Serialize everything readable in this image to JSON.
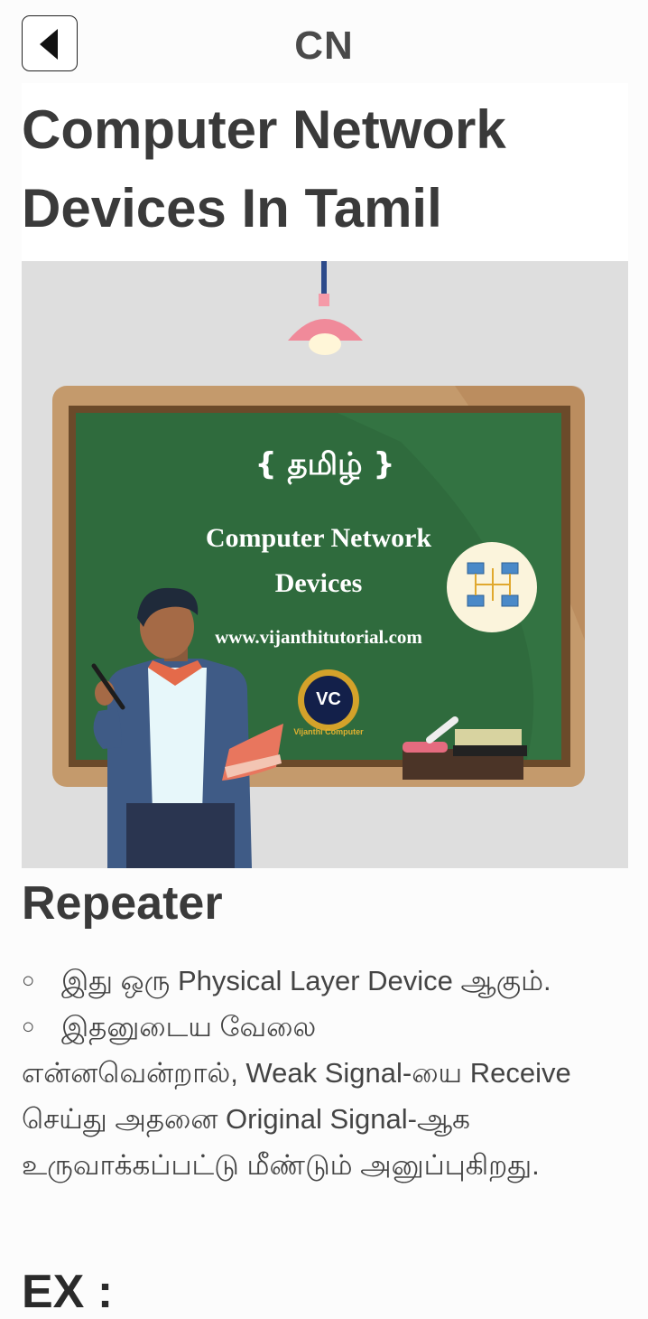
{
  "header": {
    "app_title": "CN",
    "back_icon": "chevron-left-icon"
  },
  "article": {
    "title": "Computer Network Devices In Tamil"
  },
  "hero": {
    "board_tag": "{ தமிழ் }",
    "board_title_line1": "Computer Network",
    "board_title_line2": "Devices",
    "board_url": "www.vijanthitutorial.com",
    "logo_monogram": "VC",
    "logo_caption": "Vijanthi Computer",
    "colors": {
      "background": "#dedede",
      "board": "#2f6b3d",
      "frame": "#c49a6c",
      "lamp": "#f08a9a"
    }
  },
  "section": {
    "heading": "Repeater",
    "bullet_symbol": "○",
    "items": [
      {
        "text": "இது ஒரு Physical Layer Device ஆகும்."
      },
      {
        "text_line1": "இதனுடைய வேலை",
        "text_rest": "என்னவென்றால், Weak Signal-யை Receive செய்து அதனை Original Signal-ஆக உருவாக்கப்பட்டு மீண்டும் அனுப்புகிறது."
      }
    ],
    "next_heading": "EX :"
  }
}
